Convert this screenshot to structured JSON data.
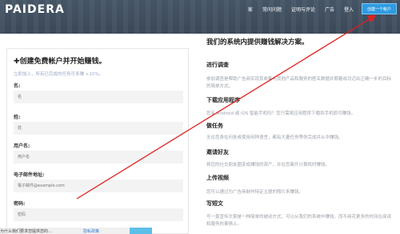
{
  "header": {
    "logo": "PAIDERA",
    "nav": [
      "家",
      "常问问题",
      "证明与评论",
      "广告",
      "登入"
    ],
    "signup_label": "创建一个帐户"
  },
  "form": {
    "title": "✚创建免费帐户并开始赚钱。",
    "subtitle": "立即加入，所有已完成的任务可多赚 +15%。",
    "fields": [
      {
        "label": "名:",
        "placeholder": "名"
      },
      {
        "label": "姓:",
        "placeholder": "姓"
      },
      {
        "label": "用户名:",
        "placeholder": "用户名"
      },
      {
        "label": "电子邮件地址:",
        "placeholder": "電子邮件@example.com"
      },
      {
        "label": "密码:",
        "placeholder": "密码"
      }
    ],
    "bottom_text": "为什么我们要求您提供您的...",
    "bottom_link": "隐私政策"
  },
  "right": {
    "title": "我们的系统内提供赚钱解决方案。",
    "sections": [
      {
        "title": "进行调查",
        "desc": "参加调查是帮助广告商实现其收集与其他产品和服务的匿名数据并朝着成功迈出正确一步的目标的简单方式。"
      },
      {
        "title": "下载应用程序",
        "desc": "您有 Android 或 iOS 智能手机吗？您只需将应用程序下载到手机即可赚钱。"
      },
      {
        "title": "做任务",
        "desc": "无论您身在何处或使用何种语言，都有大量任务等你完成并从中赚钱。"
      },
      {
        "title": "邀请好友",
        "desc": "将您的社交朋友圈变成赚钱的资产，并在您离开计算机时赚钱。"
      },
      {
        "title": "上传视频",
        "desc": "您可以通过为广告商制作特定主题的照片来赚钱。"
      },
      {
        "title": "写短文",
        "desc": "写一篇宣传文章是一种简单的被动方式，可以从我们的系统中赚钱，而不用花更多的时间在阅读和服务的事情上。"
      }
    ]
  },
  "colors": {
    "header_bg": "#3f4d5d",
    "signup_bg": "#2f9be0",
    "arrow": "#e02020"
  }
}
